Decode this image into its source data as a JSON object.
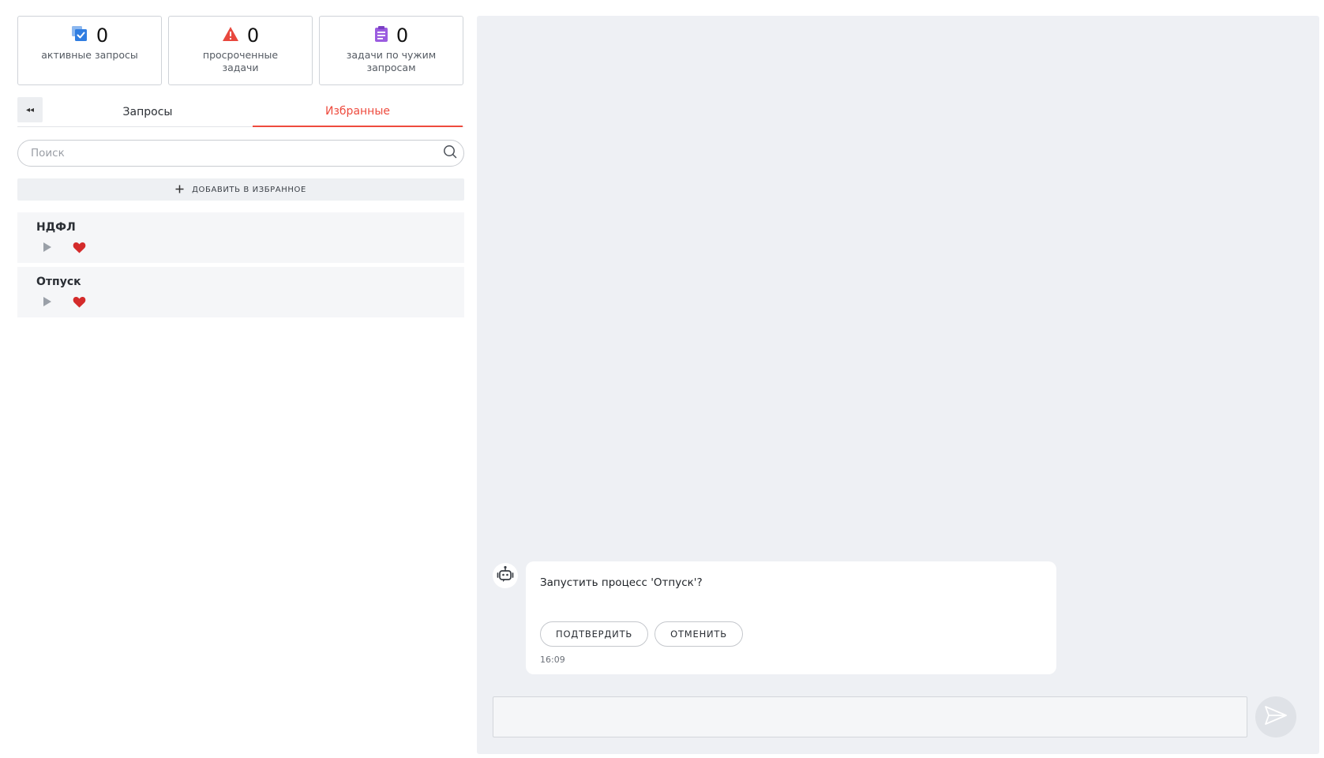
{
  "stats": [
    {
      "count": "0",
      "label": "активные запросы",
      "icon": "requests-icon",
      "color": "#2f7de1"
    },
    {
      "count": "0",
      "label": "просроченные задачи",
      "icon": "warning-icon",
      "color": "#e8483e"
    },
    {
      "count": "0",
      "label": "задачи по чужим запросам",
      "icon": "clipboard-icon",
      "color": "#9b5ce0"
    }
  ],
  "tabs": {
    "collapse_glyph": "◂◂",
    "requests_label": "Запросы",
    "favorites_label": "Избранные",
    "active": "favorites",
    "accent": "#ee4b3e"
  },
  "search": {
    "placeholder": "Поиск",
    "value": ""
  },
  "add_favorite": {
    "label": "ДОБАВИТЬ В ИЗБРАННОЕ",
    "icon": "plus-icon"
  },
  "favorites": [
    {
      "title": "НДФЛ",
      "favorited": true
    },
    {
      "title": "Отпуск",
      "favorited": true
    }
  ],
  "chat": {
    "message": {
      "text": "Запустить процесс 'Отпуск'?",
      "confirm_label": "ПОДТВЕРДИТЬ",
      "cancel_label": "ОТМЕНИТЬ",
      "time": "16:09"
    },
    "input_value": "",
    "send_icon": "send-icon"
  }
}
